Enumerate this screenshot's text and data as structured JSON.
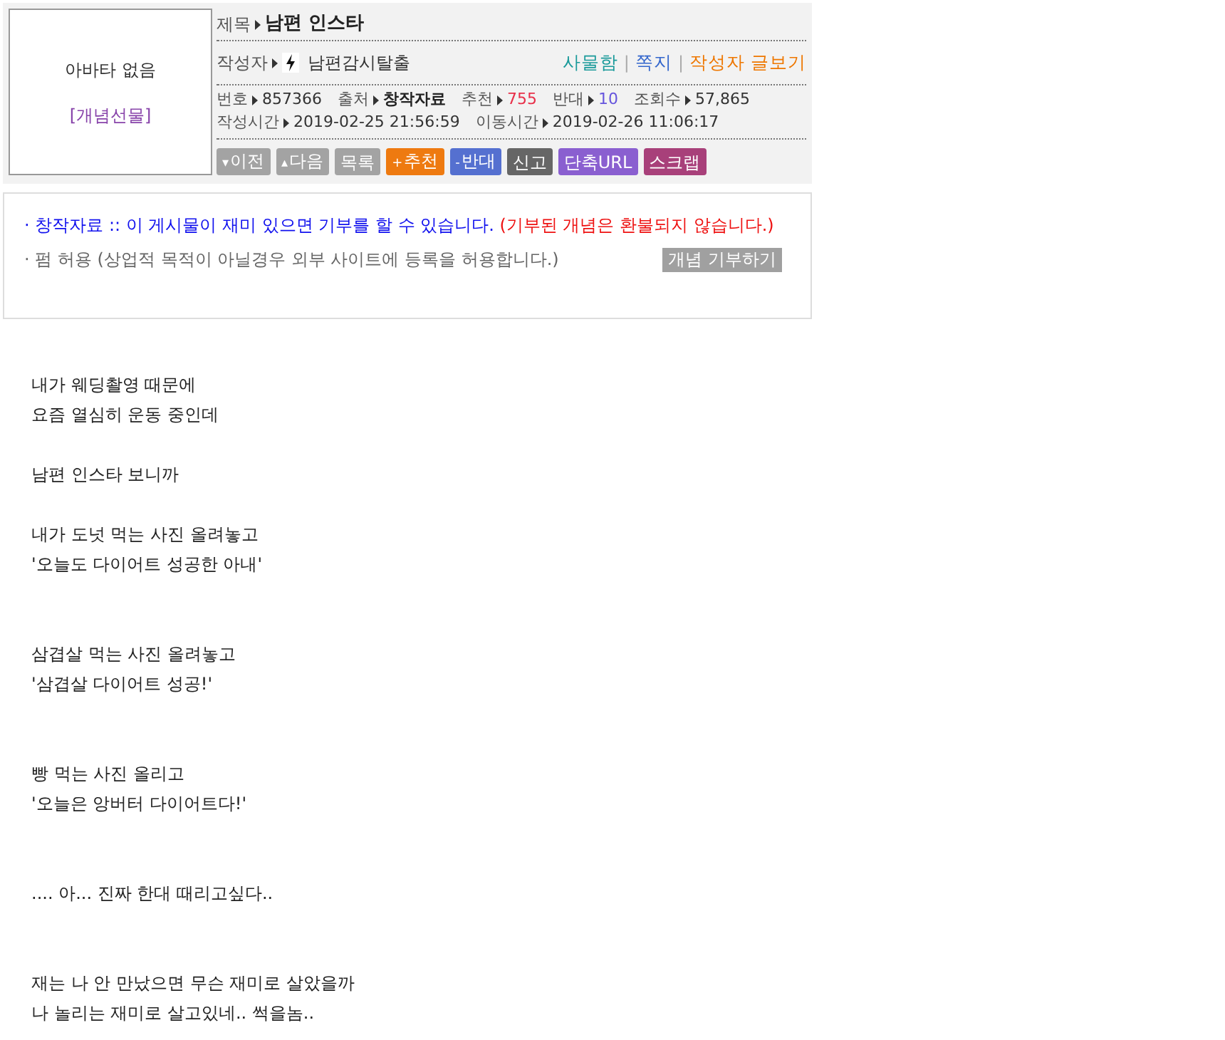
{
  "avatar": {
    "text": "아바타 없음",
    "gift_link": "[개념선물]"
  },
  "title": {
    "label": "제목",
    "value": "남편 인스타"
  },
  "author": {
    "label": "작성자",
    "name": "남편감시탈출",
    "separator": "|",
    "links": [
      {
        "text": "사물함",
        "kind": "teal"
      },
      {
        "text": "쪽지",
        "kind": "blue"
      },
      {
        "text": "작성자 글보기",
        "kind": "orange"
      }
    ]
  },
  "meta_rows": [
    [
      {
        "label": "번호",
        "value": "857366",
        "kind": "plain"
      },
      {
        "label": "출처",
        "value": "창작자료",
        "kind": "bold"
      },
      {
        "label": "추천",
        "value": "755",
        "kind": "red"
      },
      {
        "label": "반대",
        "value": "10",
        "kind": "purple"
      },
      {
        "label": "조회수",
        "value": "57,865",
        "kind": "plain"
      }
    ],
    [
      {
        "label": "작성시간",
        "value": "2019-02-25 21:56:59",
        "kind": "plain"
      },
      {
        "label": "이동시간",
        "value": "2019-02-26 11:06:17",
        "kind": "plain"
      }
    ]
  ],
  "buttons": [
    {
      "prefix": "▾",
      "text": "이전",
      "kind": "prev"
    },
    {
      "prefix": "▴",
      "text": "다음",
      "kind": "next"
    },
    {
      "text": "목록",
      "kind": "list"
    },
    {
      "prefix": "+",
      "text": "추천",
      "kind": "up"
    },
    {
      "prefix": "-",
      "text": "반대",
      "kind": "down"
    },
    {
      "text": "신고",
      "kind": "report"
    },
    {
      "text": "단축URL",
      "kind": "url"
    },
    {
      "text": "스크랩",
      "kind": "scrap"
    }
  ],
  "notice": {
    "bullet": "·",
    "line1": "창작자료 :: 이 게시물이 재미 있으면 기부를 할 수 있습니다.",
    "line1_warning": "(기부된 개념은 환불되지 않습니다.)",
    "line2": "펌 허용 (상업적 목적이 아닐경우 외부 사이트에 등록을 허용합니다.)",
    "donate_button": "개념 기부하기"
  },
  "body": [
    {
      "kind": "near",
      "lines": [
        "내가 웨딩촬영 때문에",
        "요즘 열심히 운동 중인데"
      ]
    },
    {
      "kind": "near",
      "lines": [
        "남편 인스타 보니까"
      ]
    },
    {
      "kind": "near",
      "lines": [
        "내가 도넛 먹는 사진 올려놓고",
        "'오늘도 다이어트 성공한 아내'"
      ]
    },
    {
      "kind": "far",
      "lines": [
        "삼겹살 먹는 사진 올려놓고",
        "'삼겹살 다이어트 성공!'"
      ]
    },
    {
      "kind": "far",
      "lines": [
        "빵 먹는 사진 올리고",
        "'오늘은 앙버터 다이어트다!'"
      ]
    },
    {
      "kind": "far",
      "lines": [
        ".... 아... 진짜 한대 때리고싶다.."
      ]
    },
    {
      "kind": "far",
      "lines": [
        "재는 나 안 만났으면 무슨 재미로 살았을까",
        "나 놀리는 재미로 살고있네.. 썩을놈.."
      ]
    }
  ]
}
